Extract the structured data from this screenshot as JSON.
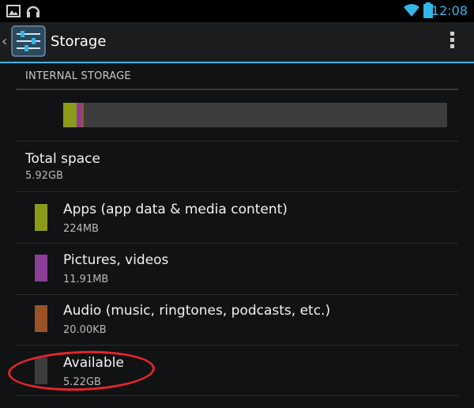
{
  "status_bar": {
    "time": "12:08",
    "icons": [
      "gallery-icon",
      "headphones-icon",
      "wifi-icon",
      "battery-icon"
    ]
  },
  "action_bar": {
    "title": "Storage",
    "icons": [
      "back-chevron-icon",
      "settings-sliders-icon",
      "overflow-menu-icon"
    ]
  },
  "section": {
    "header": "INTERNAL STORAGE"
  },
  "usage_bar": {
    "segments": [
      {
        "name": "Apps",
        "fraction": 0.036,
        "color": "#8c9a19"
      },
      {
        "name": "Pictures, videos",
        "fraction": 0.012,
        "color": "#8c3d96"
      },
      {
        "name": "Audio",
        "fraction": 0.006,
        "color": "#9a5226"
      }
    ],
    "track_color": "#3d3d3d"
  },
  "total": {
    "title": "Total space",
    "value": "5.92GB"
  },
  "items": [
    {
      "title": "Apps (app data & media content)",
      "value": "224MB",
      "color": "#8c9a19"
    },
    {
      "title": "Pictures, videos",
      "value": "11.91MB",
      "color": "#8c3d96"
    },
    {
      "title": "Audio (music, ringtones, podcasts, etc.)",
      "value": "20.00KB",
      "color": "#9a5226"
    },
    {
      "title": "Available",
      "value": "5.22GB",
      "color": "#3d3d3d"
    }
  ],
  "colors": {
    "accent": "#33b5e5",
    "annotation": "#e3262a"
  }
}
